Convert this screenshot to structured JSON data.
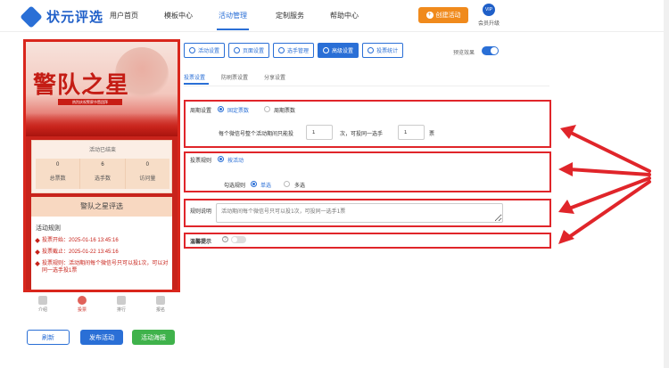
{
  "brand": {
    "name": "状元评选",
    "color": "#1f5fc8"
  },
  "nav": {
    "items": [
      "用户首页",
      "模板中心",
      "活动管理",
      "定制服务",
      "帮助中心"
    ],
    "active_index": 2,
    "create_label": "创建活动",
    "vip_icon_text": "VIP",
    "vip_label": "会员升级"
  },
  "preview": {
    "banner_title": "警队之星",
    "banner_subtitle": "热烈庆祝警察节暨团拜",
    "status_text": "活动已结束",
    "stats": [
      {
        "value": "0",
        "label": "总票数"
      },
      {
        "value": "6",
        "label": "选手数"
      },
      {
        "value": "0",
        "label": "访问量"
      }
    ],
    "rules_card_title": "警队之星评选",
    "rules_heading": "活动规则",
    "rules": [
      "投票开始：2025-01-16 13:45:16",
      "投票截止：2025-01-22 13:45:16",
      "投票规则：活动期间每个微信号只可以投1次，可以对同一选手投1票"
    ],
    "tabs": [
      {
        "label": "介绍",
        "active": false
      },
      {
        "label": "投票",
        "active": true
      },
      {
        "label": "排行",
        "active": false
      },
      {
        "label": "报名",
        "active": false
      }
    ]
  },
  "actions": {
    "refresh": "刷新",
    "publish": "发布活动",
    "poster": "活动海报"
  },
  "toolbar": {
    "items": [
      "活动设置",
      "页面设置",
      "选手管理",
      "高级设置",
      "投票统计"
    ],
    "active_index": 3,
    "preview_label": "预览效果",
    "preview_on": true
  },
  "subtabs": {
    "items": [
      "投票设置",
      "防刷票设置",
      "分享设置"
    ],
    "active_index": 0
  },
  "settings": {
    "period": {
      "label": "周期设置",
      "options": [
        "固定票数",
        "周期票数"
      ],
      "selected": 0,
      "prefix": "每个微信号整个活动期间只能投",
      "count": "1",
      "mid": "次，可投同一选手",
      "per_player": "1",
      "suffix": "票"
    },
    "rule": {
      "label": "投票规则",
      "option": "按活动",
      "sub_label": "勾选规则",
      "choices": [
        "单选",
        "多选"
      ],
      "selected": 0
    },
    "desc": {
      "label": "规则说明",
      "placeholder": "活动期间每个微信号只可以投1次，可投同一选手1票"
    },
    "tip": {
      "label": "温馨提示",
      "help_glyph": "?",
      "enabled": false
    }
  },
  "colors": {
    "accent": "#2a6fd6",
    "highlight": "#e0252a",
    "orange": "#f08a1c",
    "green": "#3fb24b",
    "banner_red": "#c8231b"
  }
}
